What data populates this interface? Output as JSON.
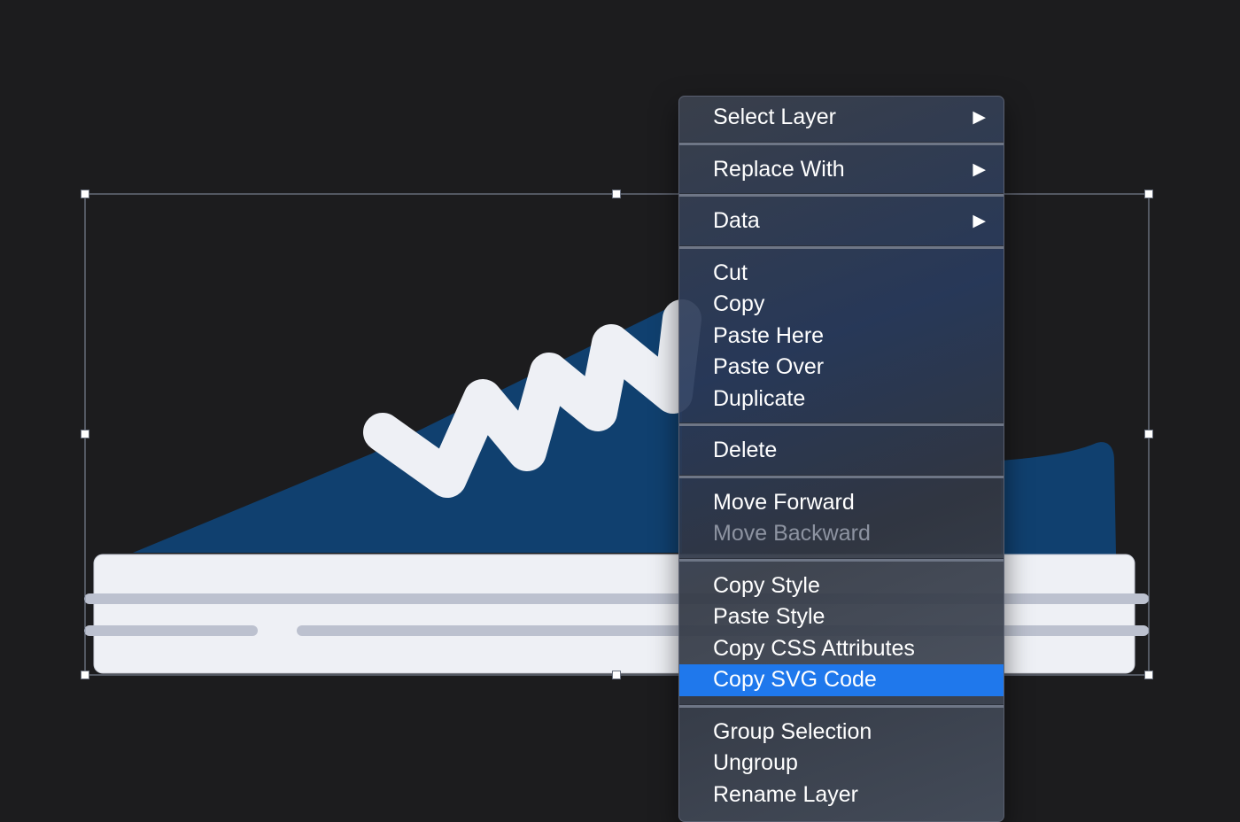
{
  "colors": {
    "background": "#1c1c1e",
    "shoe_body": "#10406f",
    "laces": "#eef0f5",
    "sole": "#eef0f5",
    "sole_stripes": "#bcc1cf",
    "menu_highlight": "#1f78ec"
  },
  "canvas": {
    "artwork": "sneaker-illustration"
  },
  "context_menu": {
    "groups": [
      [
        {
          "id": "select-layer",
          "label": "Select Layer",
          "submenu": true
        }
      ],
      [
        {
          "id": "replace-with",
          "label": "Replace With",
          "submenu": true
        }
      ],
      [
        {
          "id": "data",
          "label": "Data",
          "submenu": true
        }
      ],
      [
        {
          "id": "cut",
          "label": "Cut"
        },
        {
          "id": "copy",
          "label": "Copy"
        },
        {
          "id": "paste-here",
          "label": "Paste Here"
        },
        {
          "id": "paste-over",
          "label": "Paste Over"
        },
        {
          "id": "duplicate",
          "label": "Duplicate"
        }
      ],
      [
        {
          "id": "delete",
          "label": "Delete"
        }
      ],
      [
        {
          "id": "move-forward",
          "label": "Move Forward"
        },
        {
          "id": "move-backward",
          "label": "Move Backward",
          "disabled": true
        }
      ],
      [
        {
          "id": "copy-style",
          "label": "Copy Style"
        },
        {
          "id": "paste-style",
          "label": "Paste Style"
        },
        {
          "id": "copy-css-attributes",
          "label": "Copy CSS Attributes"
        },
        {
          "id": "copy-svg-code",
          "label": "Copy SVG Code",
          "selected": true
        }
      ],
      [
        {
          "id": "group-selection",
          "label": "Group Selection"
        },
        {
          "id": "ungroup",
          "label": "Ungroup"
        },
        {
          "id": "rename-layer",
          "label": "Rename Layer"
        }
      ]
    ],
    "submenu_arrow": "▶"
  }
}
